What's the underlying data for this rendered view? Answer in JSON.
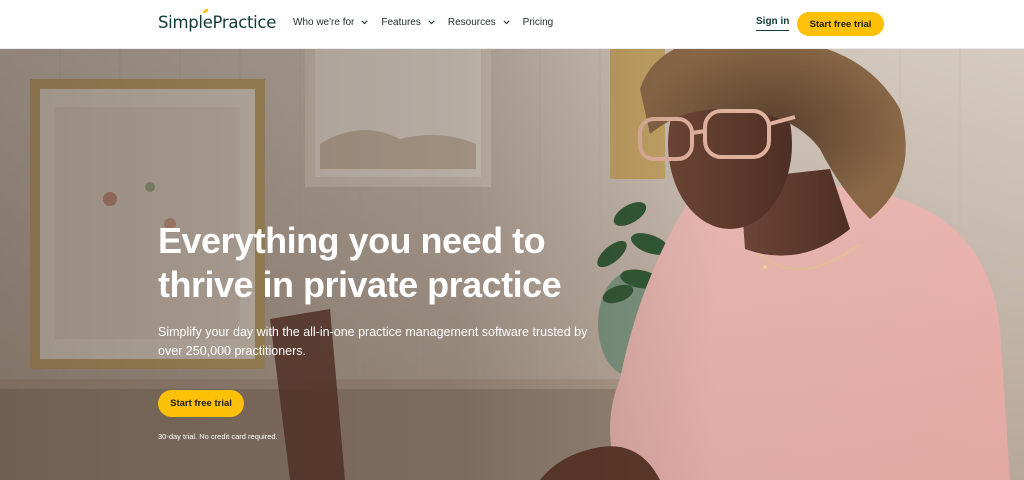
{
  "brand": {
    "name": "SimplePractice",
    "accent": "#ffc107",
    "text_color": "#0f3b33"
  },
  "header": {
    "nav": [
      {
        "label": "Who we're for",
        "has_dropdown": true
      },
      {
        "label": "Features",
        "has_dropdown": true
      },
      {
        "label": "Resources",
        "has_dropdown": true
      },
      {
        "label": "Pricing",
        "has_dropdown": false
      }
    ],
    "sign_in_label": "Sign in",
    "cta_label": "Start free trial"
  },
  "hero": {
    "title": "Everything you need to thrive in private practice",
    "subtitle": "Simplify your day with the all-in-one practice management software trusted by over 250,000 practitioners.",
    "cta_label": "Start free trial",
    "note": "30-day trial. No credit card required."
  }
}
